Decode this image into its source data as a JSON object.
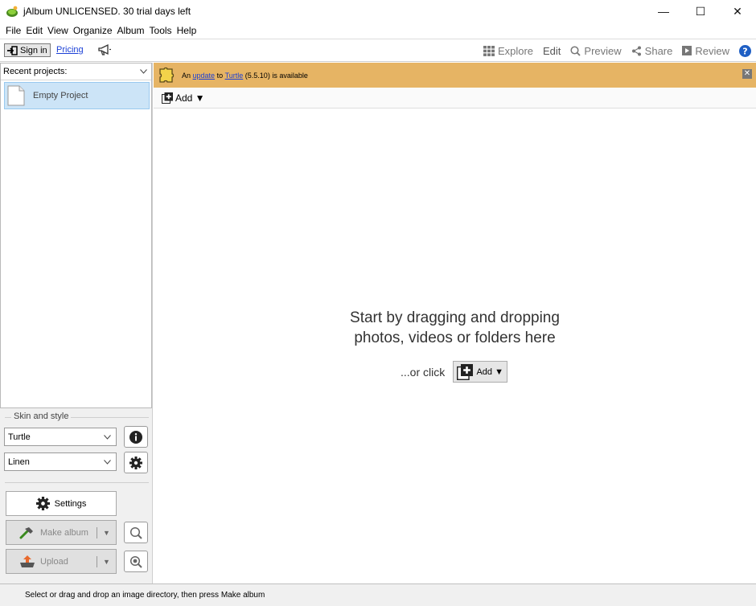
{
  "window": {
    "title": "jAlbum UNLICENSED. 30 trial days left",
    "controls": [
      "—",
      "☐",
      "✕"
    ]
  },
  "menubar": {
    "items": [
      "File",
      "Edit",
      "View",
      "Organize",
      "Album",
      "Tools",
      "Help"
    ]
  },
  "toolbar": {
    "signin_label": "Sign in",
    "pricing_label": "Pricing",
    "modes": {
      "explore": "Explore",
      "edit": "Edit",
      "preview": "Preview",
      "share": "Share",
      "review": "Review"
    },
    "active_mode": "Edit"
  },
  "left_panel": {
    "recent_header": "Recent projects:",
    "projects": [
      {
        "label": "Empty Project"
      }
    ],
    "skin_group_label": "Skin and style",
    "skin_value": "Turtle",
    "style_value": "Linen",
    "settings_label": "Settings",
    "make_album_label": "Make album",
    "upload_label": "Upload"
  },
  "banner": {
    "prefix": "An",
    "update_link": "update",
    "middle": "to",
    "skin_link": "Turtle",
    "suffix": "(5.5.10) is available"
  },
  "main": {
    "add_label": "Add ▼",
    "drop_hint_line1": "Start by dragging and dropping",
    "drop_hint_line2": "photos, videos or folders here",
    "or_click": "...or click",
    "add_button_label": "Add ▼"
  },
  "statusbar": {
    "text": "Select or drag and drop an image directory, then press Make album"
  },
  "colors": {
    "banner_bg": "#e6b464",
    "selection_bg": "#cce4f7",
    "link": "#1a3fd6",
    "help_blue": "#1f5fc4"
  }
}
